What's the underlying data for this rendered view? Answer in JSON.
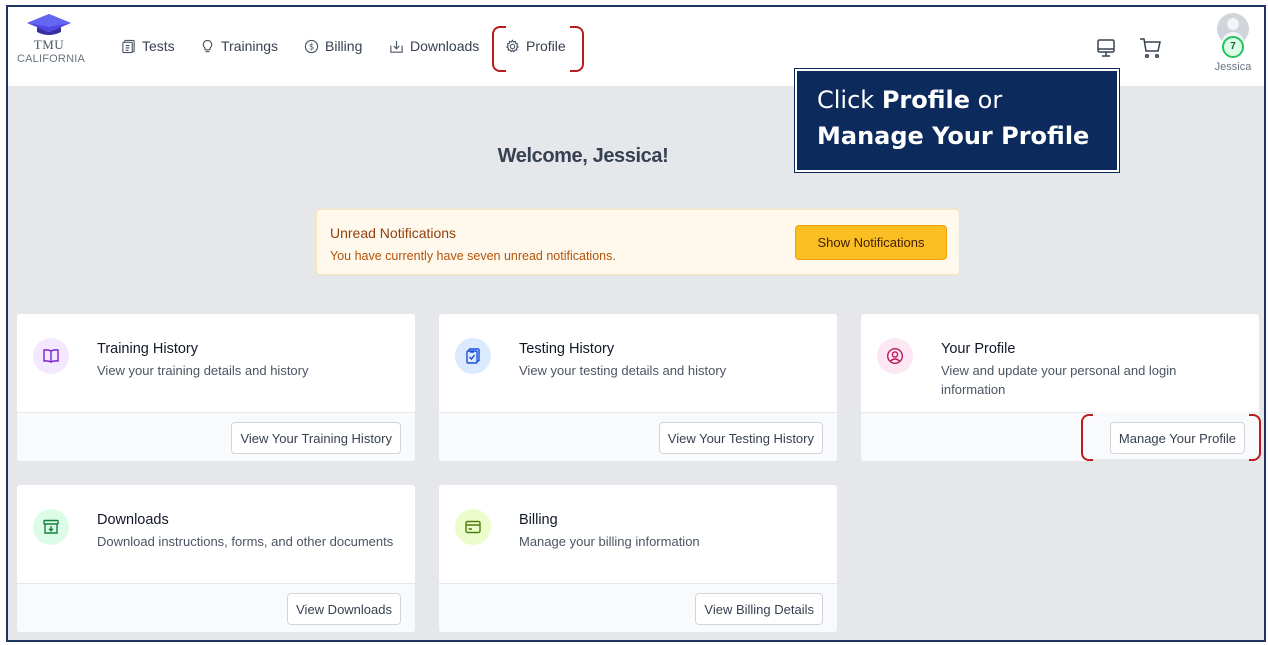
{
  "brand": {
    "line1": "TMU",
    "line2": "CALIFORNIA"
  },
  "nav": {
    "items": [
      {
        "label": "Tests",
        "icon": "tests-icon"
      },
      {
        "label": "Trainings",
        "icon": "lightbulb-icon"
      },
      {
        "label": "Billing",
        "icon": "dollar-icon"
      },
      {
        "label": "Downloads",
        "icon": "download-icon"
      },
      {
        "label": "Profile",
        "icon": "gear-icon"
      }
    ]
  },
  "user": {
    "name": "Jessica",
    "notification_count": "7"
  },
  "callout": {
    "prefix": "Click ",
    "strong1": "Profile",
    "middle": " or",
    "strong2": "Manage Your Profile"
  },
  "welcome": "Welcome, Jessica!",
  "notifications": {
    "title": "Unread Notifications",
    "text": "You have currently have seven unread notifications.",
    "button": "Show Notifications"
  },
  "cards": [
    {
      "title": "Training History",
      "desc": "View your training details and history",
      "button": "View Your Training History",
      "icon": "book-icon",
      "color": "#f3e8ff"
    },
    {
      "title": "Testing History",
      "desc": "View your testing details and history",
      "button": "View Your Testing History",
      "icon": "clipboard-check-icon",
      "color": "#dbeafe"
    },
    {
      "title": "Your Profile",
      "desc": "View and update your personal and login information",
      "button": "Manage Your Profile",
      "icon": "user-circle-icon",
      "color": "#fce7f3"
    },
    {
      "title": "Downloads",
      "desc": "Download instructions, forms, and other documents",
      "button": "View Downloads",
      "icon": "archive-icon",
      "color": "#dcfce7"
    },
    {
      "title": "Billing",
      "desc": "Manage your billing information",
      "button": "View Billing Details",
      "icon": "credit-card-icon",
      "color": "#ecfccb"
    }
  ],
  "colors": {
    "callout_bg": "#0c2b5c",
    "highlight": "#b91c1c",
    "notify_button": "#fbbf24"
  }
}
